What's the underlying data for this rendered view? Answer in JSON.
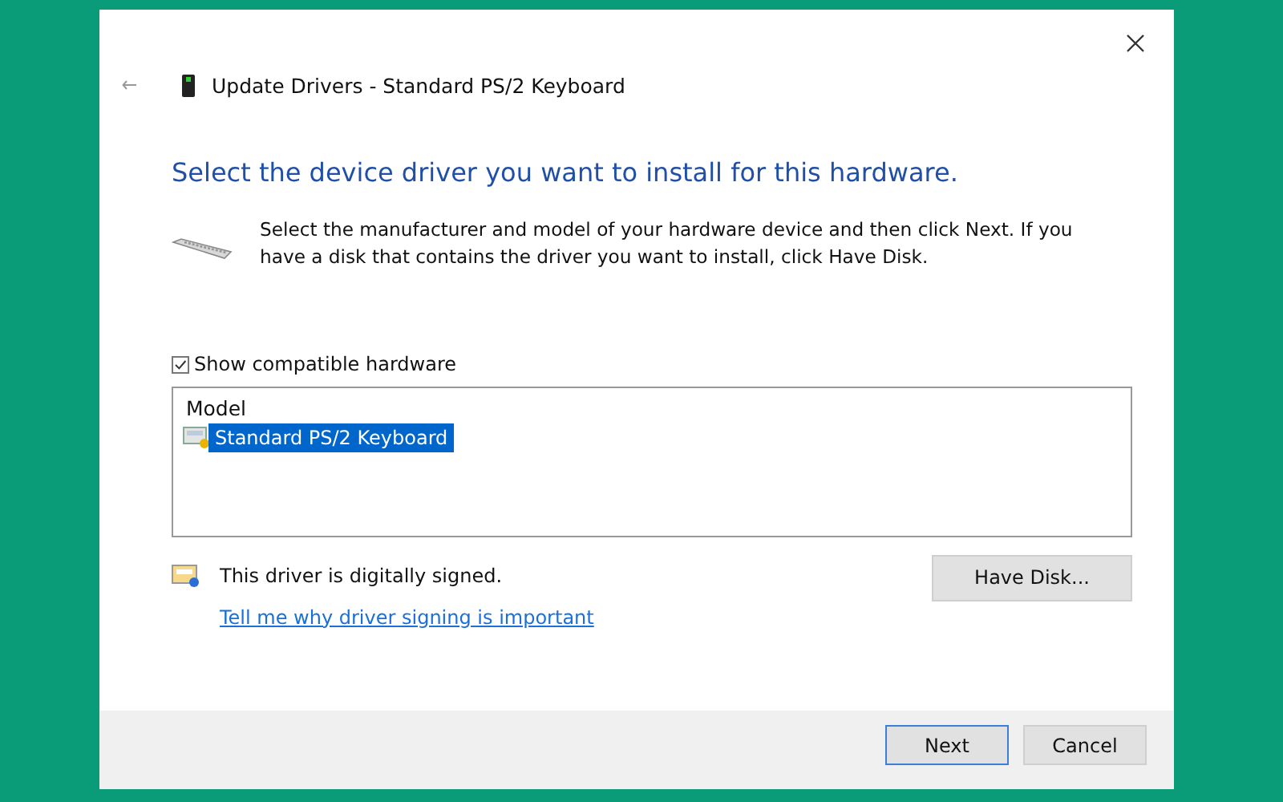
{
  "window": {
    "title": "Update Drivers - Standard PS/2 Keyboard"
  },
  "heading": "Select the device driver you want to install for this hardware.",
  "description": "Select the manufacturer and model of your hardware device and then click Next. If you have a disk that contains the driver you want to install, click Have Disk.",
  "show_compatible": {
    "label": "Show compatible hardware",
    "checked": true
  },
  "model_list": {
    "column": "Model",
    "items": [
      {
        "label": "Standard PS/2 Keyboard",
        "selected": true
      }
    ]
  },
  "signature": {
    "text": "This driver is digitally signed.",
    "link": "Tell me why driver signing is important"
  },
  "have_disk": "Have Disk...",
  "footer_buttons": [
    {
      "label": "Next",
      "default": true
    },
    {
      "label": "Cancel",
      "default": false
    }
  ]
}
